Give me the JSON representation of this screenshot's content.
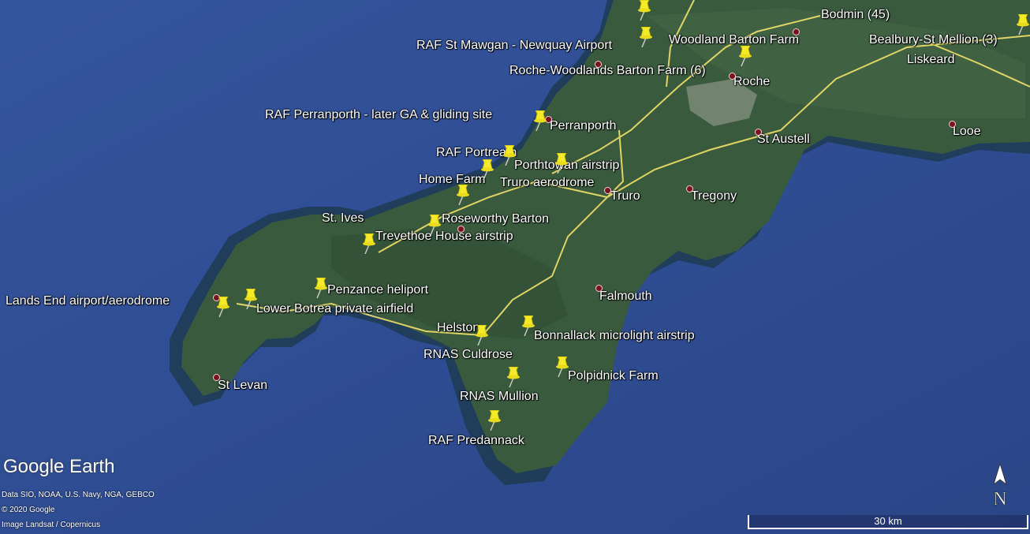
{
  "map": {
    "logo": "Google Earth",
    "attributions": [
      "Data SIO, NOAA, U.S. Navy, NGA, GEBCO",
      "© 2020 Google",
      "Image Landsat / Copernicus"
    ],
    "scale_label": "30 km",
    "north_label": "N",
    "colors": {
      "sea": "#2f4f9a",
      "land": "#35523a",
      "road": "#f2e26a",
      "pin": "#f4ea2a"
    }
  },
  "places": [
    {
      "id": "bodmin",
      "label": "Bodmin (45)"
    },
    {
      "id": "rafstmawgan",
      "label": "RAF St Mawgan - Newquay Airport"
    },
    {
      "id": "woodland",
      "label": "Woodland Barton Farm"
    },
    {
      "id": "bealbury",
      "label": "Bealbury-St Mellion (3)"
    },
    {
      "id": "liskeard",
      "label": "Liskeard"
    },
    {
      "id": "rochewood",
      "label": "Roche-Woodlands Barton Farm (6)"
    },
    {
      "id": "roche",
      "label": "Roche"
    },
    {
      "id": "rafperran",
      "label": "RAF Perranporth - later GA & gliding site"
    },
    {
      "id": "perranporth",
      "label": "Perranporth"
    },
    {
      "id": "staustell",
      "label": "St Austell"
    },
    {
      "id": "looe",
      "label": "Looe"
    },
    {
      "id": "rafportreath",
      "label": "RAF Portreath"
    },
    {
      "id": "porthtowan",
      "label": "Porthtowan airstrip"
    },
    {
      "id": "homefarm",
      "label": "Home Farm"
    },
    {
      "id": "truroaero",
      "label": "Truro aerodrome"
    },
    {
      "id": "truro",
      "label": "Truro"
    },
    {
      "id": "tregony",
      "label": "Tregony"
    },
    {
      "id": "stives",
      "label": "St. Ives"
    },
    {
      "id": "roseworthy",
      "label": "Roseworthy Barton"
    },
    {
      "id": "trevethoe",
      "label": "Trevethoe House airstrip"
    },
    {
      "id": "penzance",
      "label": "Penzance heliport"
    },
    {
      "id": "landsend",
      "label": "Lands End airport/aerodrome"
    },
    {
      "id": "lowerbotrea",
      "label": "Lower Botrea private airfield"
    },
    {
      "id": "falmouth",
      "label": "Falmouth"
    },
    {
      "id": "helston",
      "label": "Helston"
    },
    {
      "id": "bonnallack",
      "label": "Bonnallack microlight airstrip"
    },
    {
      "id": "culdrose",
      "label": "RNAS Culdrose"
    },
    {
      "id": "polpidnick",
      "label": "Polpidnick Farm"
    },
    {
      "id": "stlevan",
      "label": "St Levan"
    },
    {
      "id": "mullion",
      "label": "RNAS Mullion"
    },
    {
      "id": "predannack",
      "label": "RAF Predannack"
    }
  ]
}
